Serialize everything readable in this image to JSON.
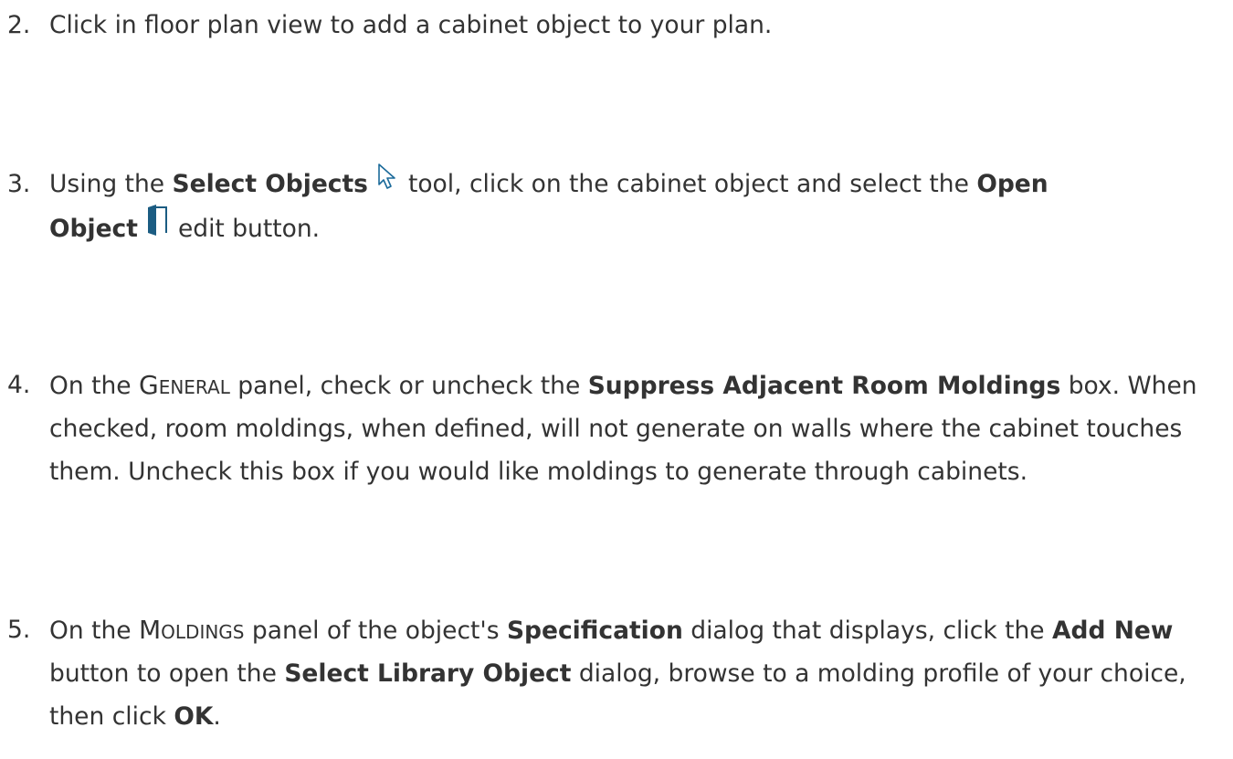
{
  "steps": [
    {
      "number": "2.",
      "text": "Click in floor plan view to add a cabinet object to your plan."
    },
    {
      "number": "3.",
      "p1": "Using the ",
      "b1": "Select Objects",
      "p2": "tool, click on the cabinet object and select the ",
      "b2a": "Open",
      "b2b": "Object",
      "p3": "edit button.",
      "icons": [
        "select-objects-icon",
        "open-object-icon"
      ]
    },
    {
      "number": "4.",
      "p1": "On the ",
      "sc1": "General",
      "p2": " panel, check or uncheck the ",
      "b1": "Suppress Adjacent Room Moldings",
      "p3": " box. When checked, room moldings, when defined, will not generate on walls where the cabinet touches them. Uncheck this box if you would like moldings to generate through cabinets."
    },
    {
      "number": "5.",
      "p1": "On the ",
      "sc1": "Moldings",
      "p2": " panel of the object's ",
      "b1": "Specification",
      "p3": " dialog that displays, click the ",
      "b2": "Add New",
      "p4": " button to open the ",
      "b3": "Select Library Object",
      "p5": " dialog, browse to a molding profile of your choice, then click ",
      "b4": "OK",
      "p6": "."
    }
  ],
  "colors": {
    "text": "#333333",
    "open_object_icon": "#1b5c82"
  }
}
